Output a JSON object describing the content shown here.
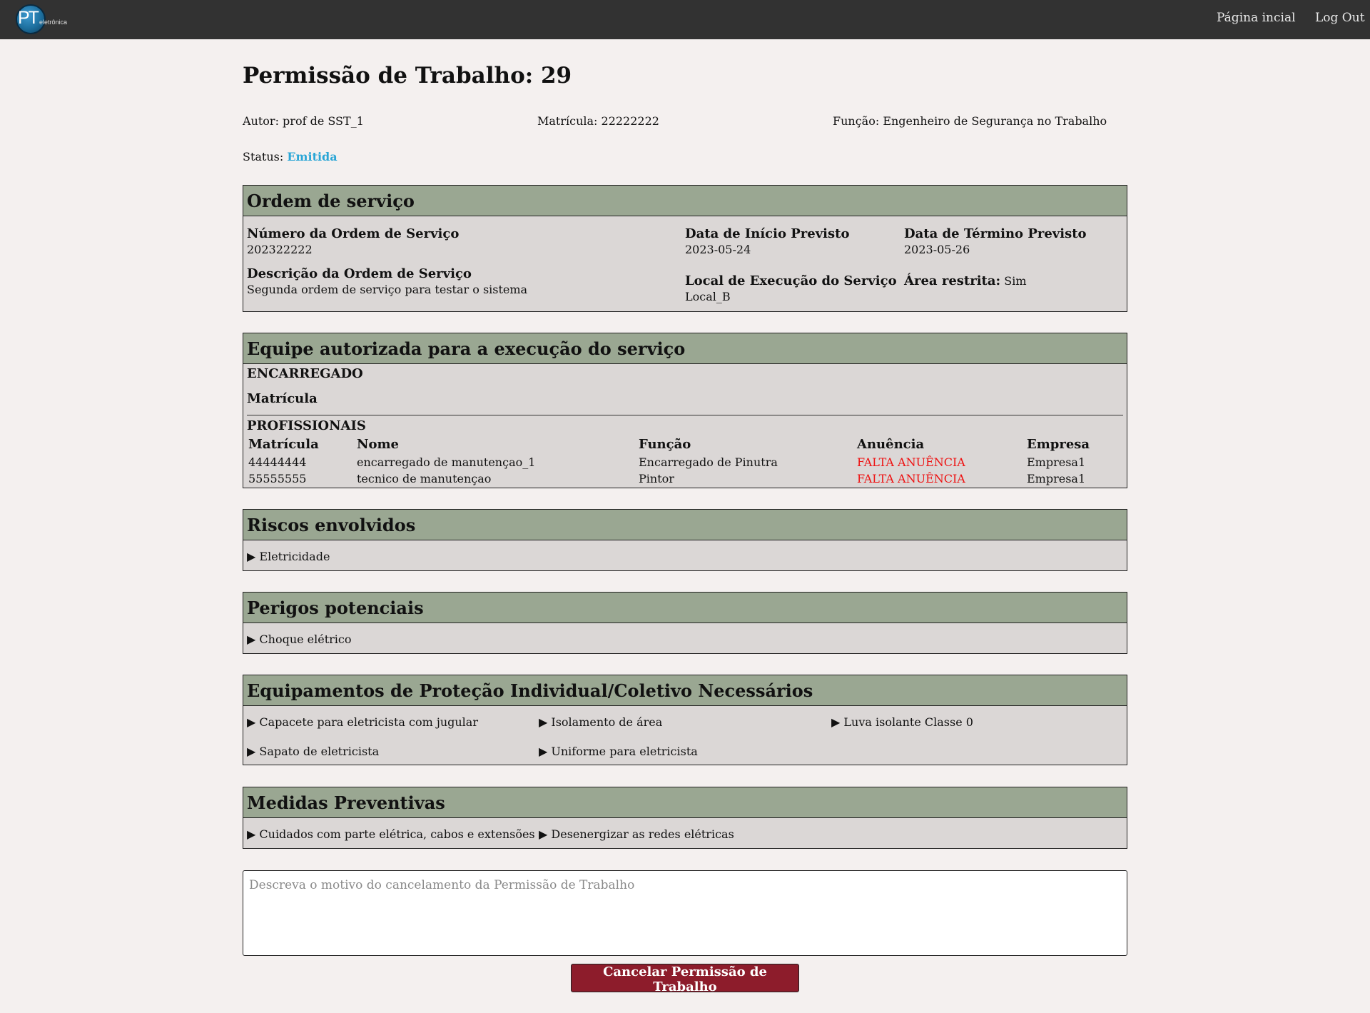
{
  "navbar": {
    "logo_text": "PT",
    "logo_sub": "eletrônica",
    "home_label": "Página incial",
    "logout_label": "Log Out"
  },
  "permit": {
    "title": "Permissão de Trabalho: 29",
    "autor": "Autor: prof de SST_1",
    "matricula": "Matrícula: 22222222",
    "funcao": "Função: Engenheiro de Segurança no Trabalho",
    "status_label": "Status:",
    "status_value": "Emitida"
  },
  "ordem": {
    "header": "Ordem de serviço",
    "numero_label": "Número da Ordem de Serviço",
    "numero_value": "202322222",
    "descricao_label": "Descrição da Ordem de Serviço",
    "descricao_value": "Segunda ordem de serviço para testar o sistema",
    "inicio_label": "Data de Início Previsto",
    "inicio_value": "2023-05-24",
    "termino_label": "Data de Término Previsto",
    "termino_value": "2023-05-26",
    "local_label": "Local de Execução do Serviço",
    "local_value": "Local_B",
    "area_label": "Área restrita:",
    "area_value": "Sim"
  },
  "equipe": {
    "header": "Equipe autorizada para a execução do serviço",
    "encarregado_label": "ENCARREGADO",
    "encarregado_matricula_label": "Matrícula",
    "profissionais_label": "PROFISSIONAIS",
    "columns": [
      "Matrícula",
      "Nome",
      "Função",
      "Anuência",
      "Empresa"
    ],
    "rows": [
      [
        "44444444",
        "encarregado de manutençao_1",
        "Encarregado de Pinutra",
        "FALTA ANUÊNCIA",
        "Empresa1"
      ],
      [
        "55555555",
        "tecnico de manutençao",
        "Pintor",
        "FALTA ANUÊNCIA",
        "Empresa1"
      ]
    ],
    "status_color": "#ee1111"
  },
  "riscos": {
    "header": "Riscos envolvidos",
    "items": [
      "▶ Eletricidade"
    ]
  },
  "perigos": {
    "header": "Perigos potenciais",
    "items": [
      "▶ Choque elétrico"
    ]
  },
  "epi": {
    "header": "Equipamentos de Proteção Individual/Coletivo Necessários",
    "items": [
      "▶ Capacete para eletricista com jugular",
      "▶ Isolamento de área",
      "▶ Luva isolante Classe 0",
      "▶ Sapato de eletricista",
      "▶ Uniforme para eletricista"
    ]
  },
  "medidas": {
    "header": "Medidas Preventivas",
    "items": [
      "▶ Cuidados com parte elétrica, cabos e extensões",
      "▶ Desenergizar as redes elétricas"
    ]
  },
  "cancel": {
    "placeholder": "Descreva o motivo do cancelamento da Permissão de Trabalho",
    "value": "",
    "button_label": "Cancelar Permissão de Trabalho"
  },
  "colors": {
    "navbar": "#323232",
    "section_header": "#9aa792",
    "section_body": "#dbd7d6",
    "status": "#2aa6d6",
    "cancel_button": "#8d1c2b"
  }
}
